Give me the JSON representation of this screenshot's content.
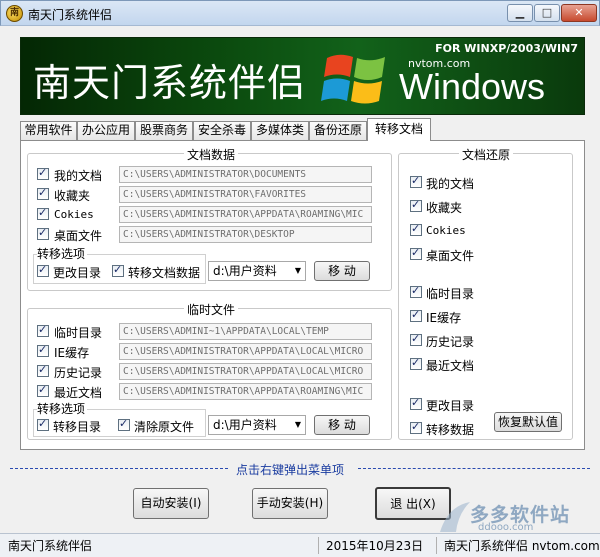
{
  "window": {
    "title": "南天门系统伴侣",
    "icon_text": "南"
  },
  "banner": {
    "title": "南天门系统伴侣",
    "for_text": "FOR WINXP/2003/WIN7",
    "site": "nvtom.com",
    "windows": "Windows"
  },
  "tabs": [
    "常用软件",
    "办公应用",
    "股票商务",
    "安全杀毒",
    "多媒体类",
    "备份还原",
    "转移文档"
  ],
  "docs": {
    "title": "文档数据",
    "items": [
      {
        "label": "我的文档",
        "path": "C:\\USERS\\ADMINISTRATOR\\DOCUMENTS"
      },
      {
        "label": "收藏夹",
        "path": "C:\\USERS\\ADMINISTRATOR\\FAVORITES"
      },
      {
        "label": "Cokies",
        "path": "C:\\USERS\\ADMINISTRATOR\\APPDATA\\ROAMING\\MIC"
      },
      {
        "label": "桌面文件",
        "path": "C:\\USERS\\ADMINISTRATOR\\DESKTOP"
      }
    ],
    "options_title": "转移选项",
    "opt1": "更改目录",
    "opt2": "转移文档数据",
    "target": "d:\\用户资料",
    "move": "移 动"
  },
  "temp": {
    "title": "临时文件",
    "items": [
      {
        "label": "临时目录",
        "path": "C:\\USERS\\ADMINI~1\\APPDATA\\LOCAL\\TEMP"
      },
      {
        "label": "IE缓存",
        "path": "C:\\USERS\\ADMINISTRATOR\\APPDATA\\LOCAL\\MICRO"
      },
      {
        "label": "历史记录",
        "path": "C:\\USERS\\ADMINISTRATOR\\APPDATA\\LOCAL\\MICRO"
      },
      {
        "label": "最近文档",
        "path": "C:\\USERS\\ADMINISTRATOR\\APPDATA\\ROAMING\\MIC"
      }
    ],
    "options_title": "转移选项",
    "opt1": "转移目录",
    "opt2": "清除原文件",
    "target": "d:\\用户资料",
    "move": "移 动"
  },
  "restore": {
    "title": "文档还原",
    "items": [
      "我的文档",
      "收藏夹",
      "Cokies",
      "桌面文件",
      "临时目录",
      "IE缓存",
      "历史记录",
      "最近文档",
      "更改目录",
      "转移数据"
    ],
    "default_btn": "恢复默认值"
  },
  "hint": "点击右键弹出菜单项",
  "buttons": {
    "auto": "自动安装(I)",
    "manual": "手动安装(H)",
    "exit": "退 出(X)"
  },
  "status": {
    "app": "南天门系统伴侣",
    "date": "2015年10月23日",
    "site": "南天门系统伴侣 nvtom.com"
  },
  "watermark": {
    "name": "多多软件站",
    "url": "ddooo.com"
  }
}
